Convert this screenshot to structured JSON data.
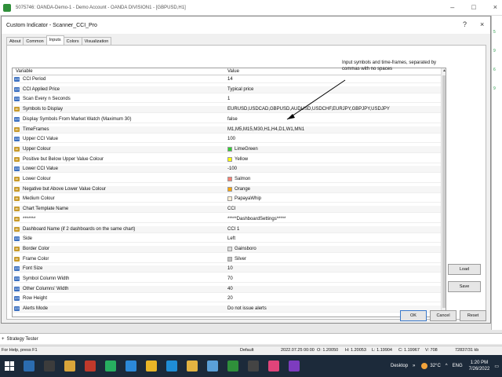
{
  "window": {
    "title": "5075746: OANDA-Demo-1 - Demo Account - OANDA DIVISION1 - [GBPUSD,H1]"
  },
  "dialog": {
    "title": "Custom Indicator - Scanner_CCI_Pro",
    "help": "?",
    "close": "×",
    "tabs": [
      "About",
      "Common",
      "Inputs",
      "Colors",
      "Visualization"
    ],
    "active_tab": "Inputs",
    "columns": {
      "variable": "Variable",
      "value": "Value"
    },
    "rows": [
      {
        "icon": "123",
        "icon_color": "blue",
        "variable": "CCI Period",
        "value": "14"
      },
      {
        "icon": "123",
        "icon_color": "blue",
        "variable": "CCI Applied Price",
        "value": "Typical price"
      },
      {
        "icon": "123",
        "icon_color": "blue",
        "variable": "Scan Every n Seconds",
        "value": "1"
      },
      {
        "icon": "ab",
        "icon_color": "gold",
        "variable": "Symbols to Display",
        "value": "EURUSD,USDCAD,GBPUSD,AUDUSD,USDCHF,EURJPY,GBPJPY,USDJPY"
      },
      {
        "icon": "123",
        "icon_color": "blue",
        "variable": "Display Symbols From Market Watch (Maximum 30)",
        "value": "false"
      },
      {
        "icon": "ab",
        "icon_color": "gold",
        "variable": "TimeFrames",
        "value": "M1,M5,M15,M30,H1,H4,D1,W1,MN1"
      },
      {
        "icon": "123",
        "icon_color": "blue",
        "variable": "Upper CCI Value",
        "value": "100"
      },
      {
        "icon": "clr",
        "icon_color": "gold",
        "variable": "Upper Colour",
        "value": "LimeGreen",
        "swatch": "#32cd32"
      },
      {
        "icon": "clr",
        "icon_color": "gold",
        "variable": "Positive but Below Upper Value Colour",
        "value": "Yellow",
        "swatch": "#ffff00"
      },
      {
        "icon": "123",
        "icon_color": "blue",
        "variable": "Lower CCI Value",
        "value": "-100"
      },
      {
        "icon": "clr",
        "icon_color": "gold",
        "variable": "Lower Colour",
        "value": "Salmon",
        "swatch": "#fa8072"
      },
      {
        "icon": "clr",
        "icon_color": "gold",
        "variable": "Negative but Above Lower Value Colour",
        "value": "Orange",
        "swatch": "#ffa500"
      },
      {
        "icon": "clr",
        "icon_color": "gold",
        "variable": "Medium Colour",
        "value": "PapayaWhip",
        "swatch": "#ffefd5"
      },
      {
        "icon": "ab",
        "icon_color": "gold",
        "variable": "Chart Template Name",
        "value": "CCI"
      },
      {
        "icon": "ab",
        "icon_color": "gold",
        "variable": "*******",
        "value": "*****DashboardSettings*****"
      },
      {
        "icon": "ab",
        "icon_color": "gold",
        "variable": "Dashboard Name (if 2 dashboards on the same chart)",
        "value": "CCI 1"
      },
      {
        "icon": "123",
        "icon_color": "blue",
        "variable": "Side",
        "value": "Left"
      },
      {
        "icon": "clr",
        "icon_color": "gold",
        "variable": "Border Color",
        "value": "Gainsboro",
        "swatch": "#dcdcdc"
      },
      {
        "icon": "clr",
        "icon_color": "gold",
        "variable": "Frame Color",
        "value": "Silver",
        "swatch": "#c0c0c0"
      },
      {
        "icon": "123",
        "icon_color": "blue",
        "variable": "Font Size",
        "value": "10"
      },
      {
        "icon": "123",
        "icon_color": "blue",
        "variable": "Symbol Column Width",
        "value": "70"
      },
      {
        "icon": "123",
        "icon_color": "blue",
        "variable": "Other Columns' Width",
        "value": "40"
      },
      {
        "icon": "123",
        "icon_color": "blue",
        "variable": "Row Height",
        "value": "20"
      },
      {
        "icon": "123",
        "icon_color": "blue",
        "variable": "Alerts Mode",
        "value": "Do not issue alerts"
      }
    ],
    "annotation": "Input symbols and time-frames, separated by commas with no spaces",
    "buttons": {
      "load": "Load",
      "save": "Save",
      "ok": "OK",
      "cancel": "Cancel",
      "reset": "Reset"
    }
  },
  "bottom": {
    "strategy_tester": "Strategy Tester",
    "status": {
      "help": "For Help, press F1",
      "profile": "Default",
      "datetime": "2022.07.25 00:00",
      "open": "O: 1.20050",
      "high": "H: 1.20053",
      "low": "L: 1.19904",
      "close": "C: 1.19967",
      "volume": "V: 708",
      "traffic": "72837/31 kb"
    }
  },
  "taskbar": {
    "desktop": "Desktop",
    "temperature": "32°C",
    "language": "ENG",
    "time": "1:20 PM",
    "date": "7/26/2022"
  }
}
